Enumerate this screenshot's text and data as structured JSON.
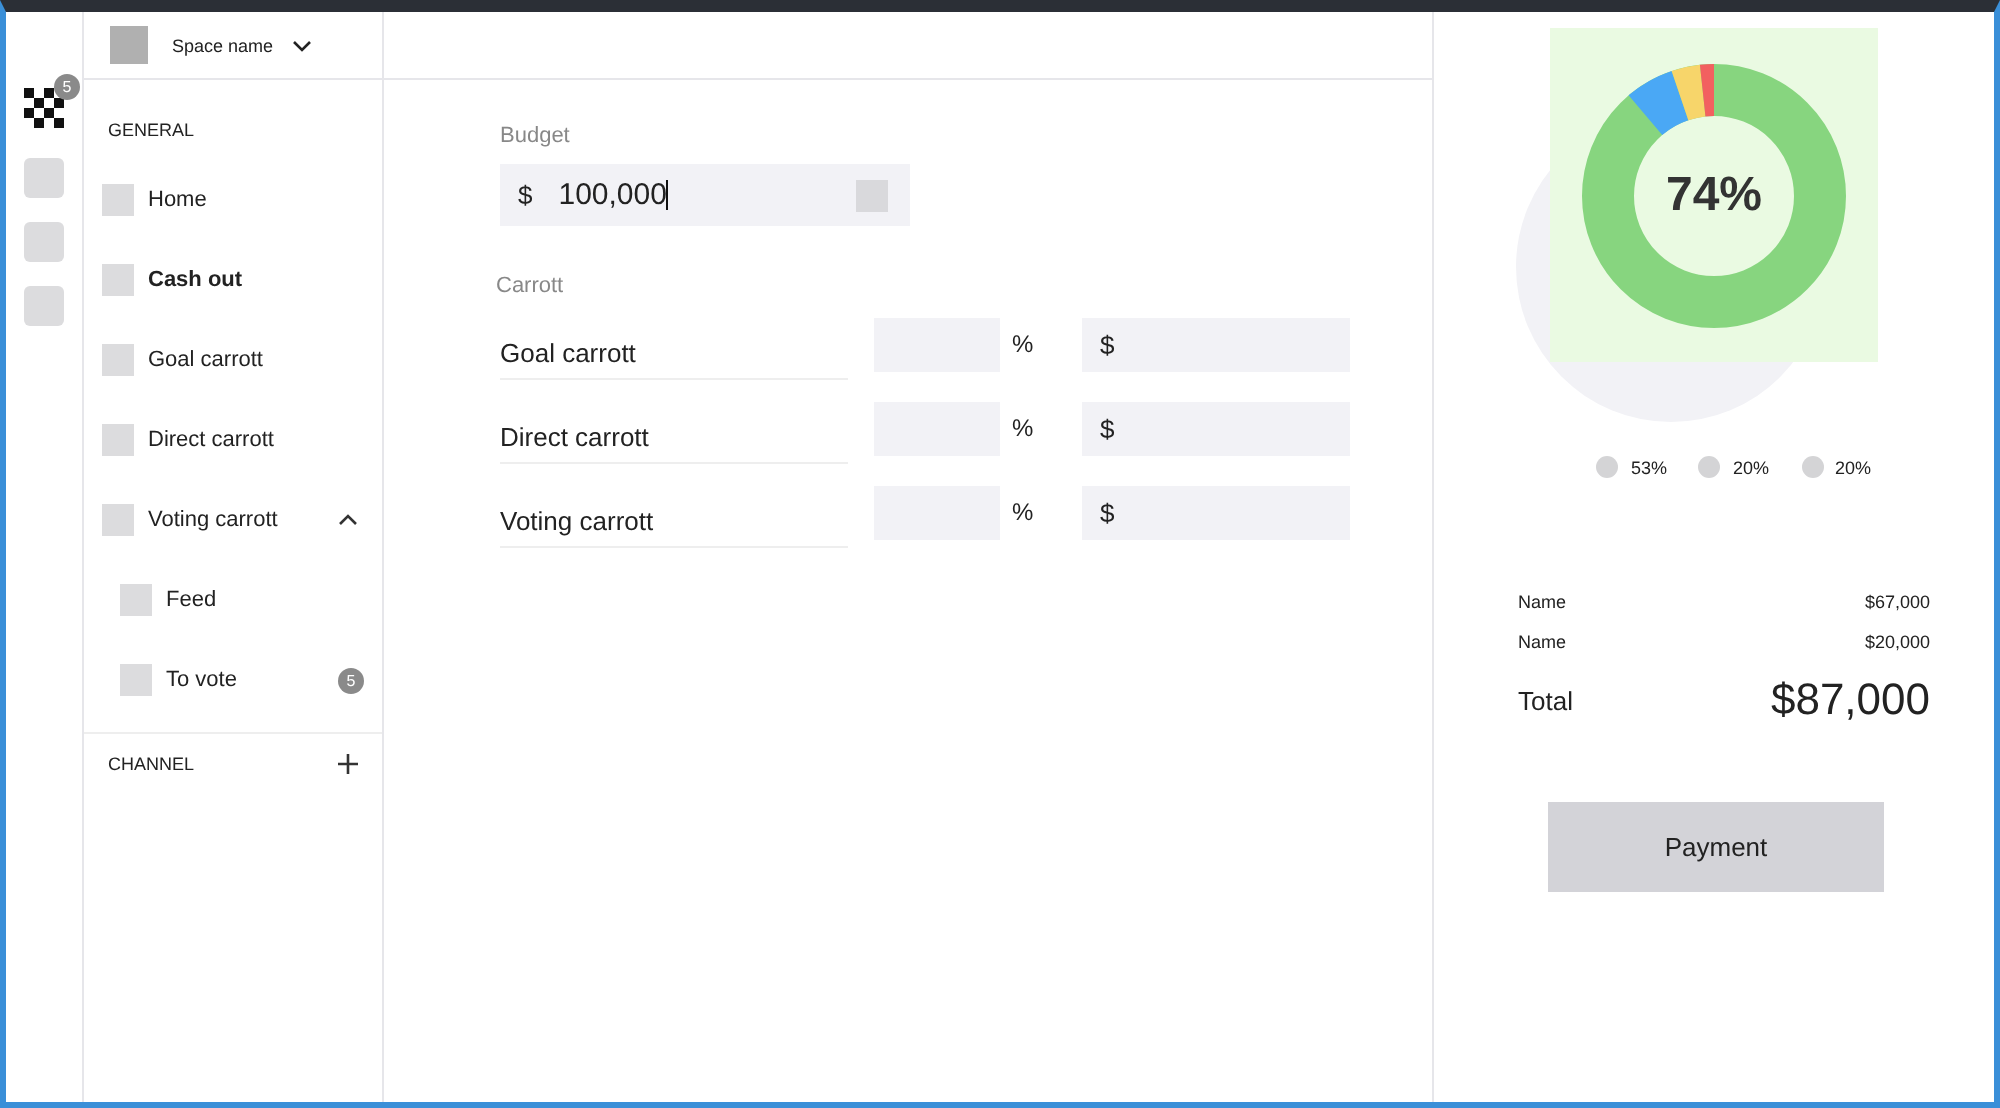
{
  "rail": {
    "badge": "5"
  },
  "header": {
    "space_name": "Space name"
  },
  "sidebar": {
    "sections": [
      {
        "title": "GENERAL",
        "items": [
          {
            "label": "Home",
            "selected": false
          },
          {
            "label": "Cash out",
            "selected": true
          },
          {
            "label": "Goal carrott",
            "selected": false
          },
          {
            "label": "Direct carrott",
            "selected": false
          },
          {
            "label": "Voting carrott",
            "selected": false,
            "expanded": true,
            "children": [
              {
                "label": "Feed",
                "selected": false
              },
              {
                "label": "To vote",
                "selected": false,
                "badge": "5"
              }
            ]
          }
        ]
      },
      {
        "title": "CHANNEL"
      }
    ]
  },
  "budget": {
    "label": "Budget",
    "currency": "$",
    "value": "100,000"
  },
  "carrott": {
    "label": "Carrott",
    "rows": [
      {
        "name": "Goal carrott",
        "percent_sign": "%",
        "currency": "$"
      },
      {
        "name": "Direct carrott",
        "percent_sign": "%",
        "currency": "$"
      },
      {
        "name": "Voting carrott",
        "percent_sign": "%",
        "currency": "$"
      }
    ]
  },
  "summary": {
    "center_label": "74%",
    "legend": [
      "53%",
      "20%",
      "20%"
    ],
    "lines": [
      {
        "name": "Name",
        "amount": "$67,000"
      },
      {
        "name": "Name",
        "amount": "$20,000"
      }
    ],
    "total_label": "Total",
    "total": "$87,000",
    "button": "Payment"
  }
}
